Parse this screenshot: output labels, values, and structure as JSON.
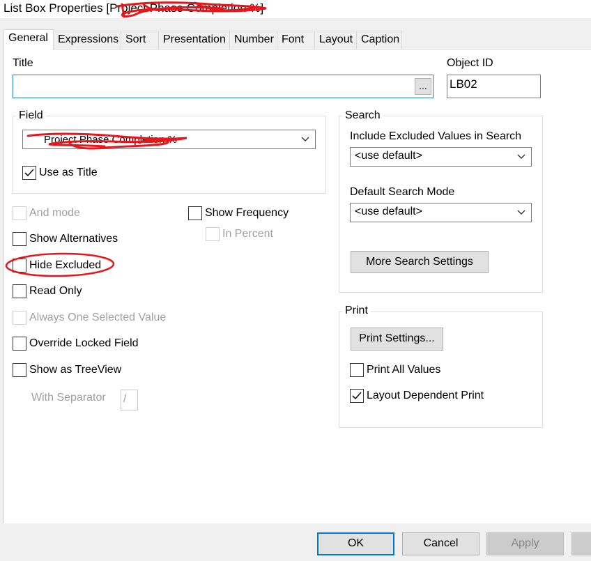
{
  "window": {
    "title": "List Box Properties [Project Phase Completion %]"
  },
  "tabs": [
    {
      "label": "General",
      "active": true
    },
    {
      "label": "Expressions"
    },
    {
      "label": "Sort"
    },
    {
      "label": "Presentation"
    },
    {
      "label": "Number"
    },
    {
      "label": "Font"
    },
    {
      "label": "Layout"
    },
    {
      "label": "Caption"
    }
  ],
  "title_section": {
    "label": "Title",
    "value": "",
    "browse_label": "..."
  },
  "object_id": {
    "label": "Object ID",
    "value": "LB02"
  },
  "field": {
    "legend": "Field",
    "value": "Project Phase Completion %",
    "use_as_title": {
      "label": "Use as Title",
      "checked": true
    }
  },
  "options": {
    "and_mode": {
      "label": "And mode",
      "checked": false,
      "enabled": false
    },
    "show_frequency": {
      "label": "Show Frequency",
      "checked": false,
      "enabled": true
    },
    "in_percent": {
      "label": "In Percent",
      "checked": false,
      "enabled": false
    },
    "show_alternatives": {
      "label": "Show Alternatives",
      "checked": false,
      "enabled": true
    },
    "hide_excluded": {
      "label": "Hide Excluded",
      "checked": false,
      "enabled": true
    },
    "read_only": {
      "label": "Read Only",
      "checked": false,
      "enabled": true
    },
    "always_one_selected": {
      "label": "Always One Selected Value",
      "checked": false,
      "enabled": false
    },
    "override_locked": {
      "label": "Override Locked Field",
      "checked": false,
      "enabled": true
    },
    "show_as_treeview": {
      "label": "Show as TreeView",
      "checked": false,
      "enabled": true
    },
    "with_separator": {
      "label": "With Separator",
      "value": "/",
      "enabled": false
    }
  },
  "search": {
    "legend": "Search",
    "include_excluded_label": "Include Excluded Values in Search",
    "include_excluded_value": "<use default>",
    "default_mode_label": "Default Search Mode",
    "default_mode_value": "<use default>",
    "more_settings_label": "More Search Settings"
  },
  "print": {
    "legend": "Print",
    "settings_label": "Print Settings...",
    "print_all_values": {
      "label": "Print All Values",
      "checked": false
    },
    "layout_dependent": {
      "label": "Layout Dependent Print",
      "checked": true
    }
  },
  "footer": {
    "ok": "OK",
    "cancel": "Cancel",
    "apply": "Apply"
  },
  "annotations": {
    "redaction_color": "#e8161b",
    "highlight_color": "#e8161b"
  }
}
